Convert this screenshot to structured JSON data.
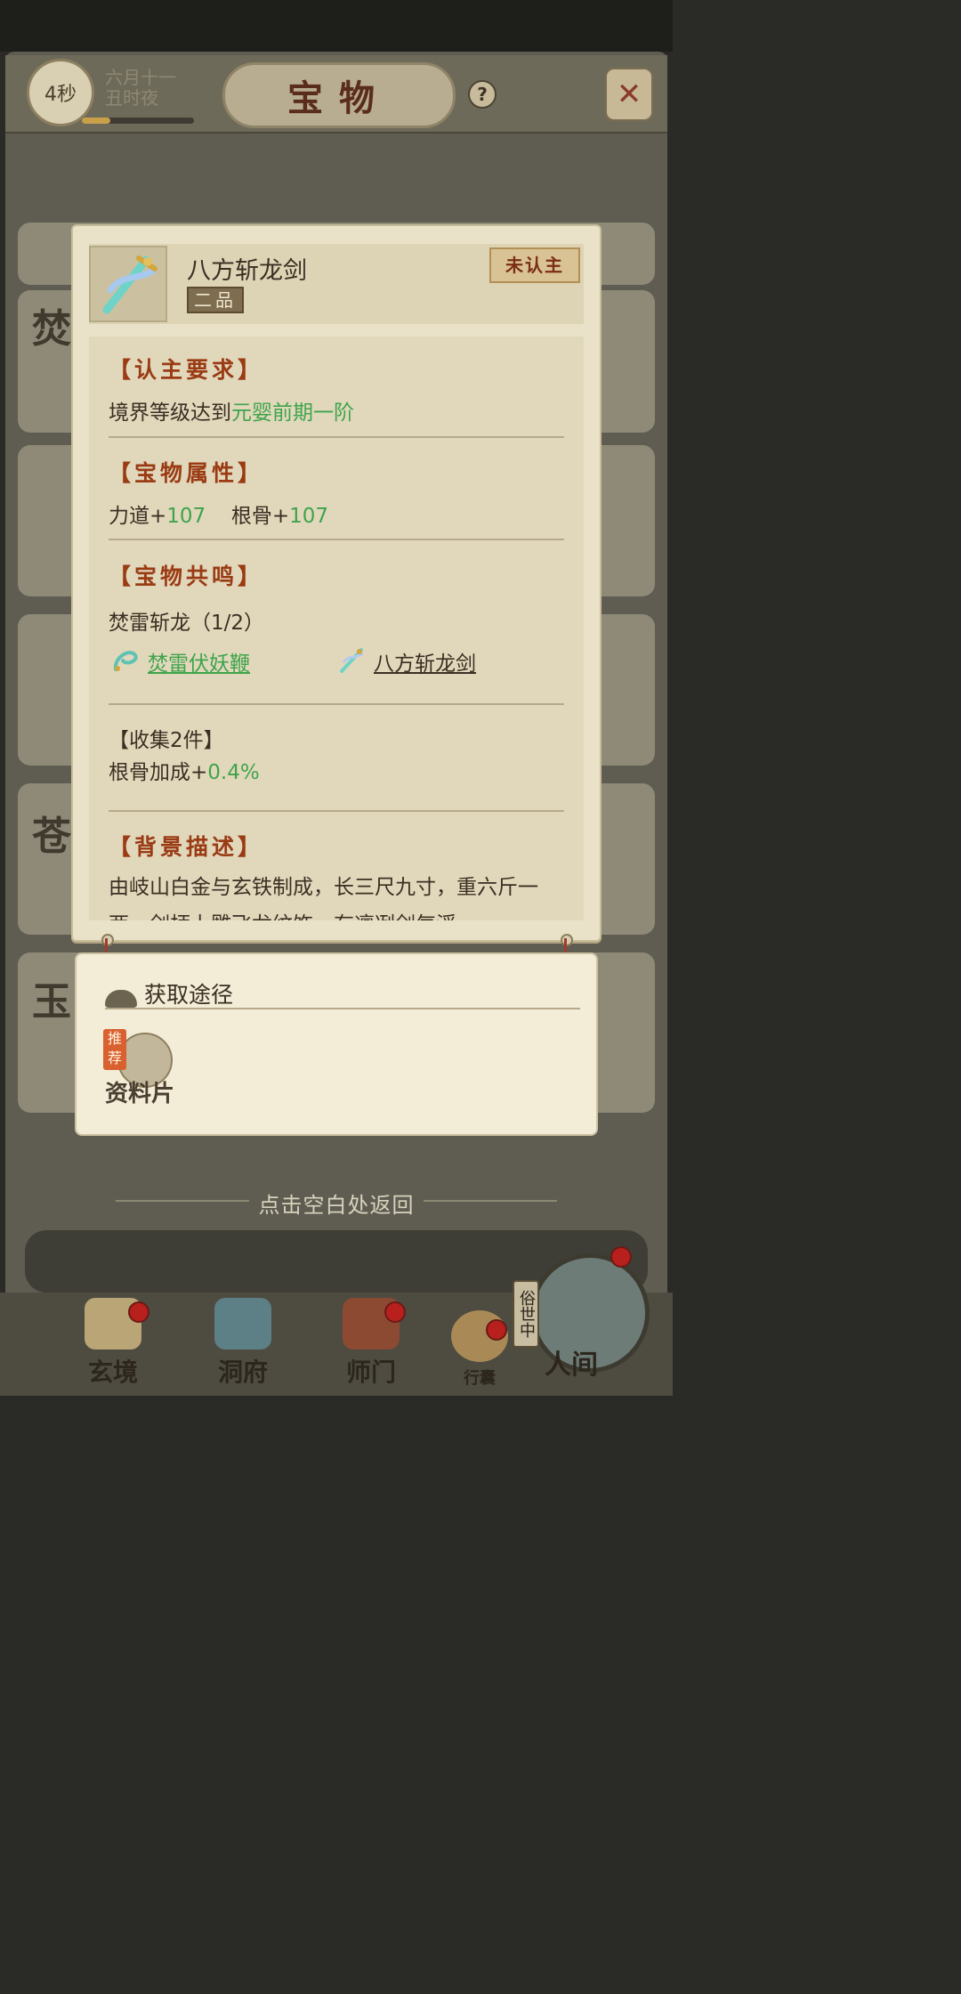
{
  "header": {
    "timer": "4秒",
    "date_line1": "六月十一",
    "date_line2": "丑时夜",
    "date_progress": 0.25,
    "title": "宝物",
    "help_icon": "question-mark-icon",
    "close_icon": "close-x-icon"
  },
  "item": {
    "name": "八方斩龙剑",
    "grade": "二品",
    "status": "未认主",
    "icon": "sword-icon"
  },
  "requirement": {
    "title": "【认主要求】",
    "text_prefix": "境界等级达到",
    "text_value": "元婴前期一阶"
  },
  "attributes": {
    "title": "【宝物属性】",
    "items": [
      {
        "label": "力道+",
        "value": "107"
      },
      {
        "label": "根骨+",
        "value": "107"
      }
    ]
  },
  "resonance": {
    "title": "【宝物共鸣】",
    "set_name": "焚雷斩龙（1/2）",
    "pieces": [
      {
        "name": "焚雷伏妖鞭",
        "icon": "whip-icon",
        "color": "#3fa44b"
      },
      {
        "name": "八方斩龙剑",
        "icon": "sword-icon",
        "color": "#3a2f22"
      }
    ],
    "bonus_title": "【收集2件】",
    "bonus_label": "根骨加成+",
    "bonus_value": "0.4%"
  },
  "background": {
    "title": "【背景描述】",
    "text": "由岐山白金与玄铁制成，长三尺九寸，重六斤一两，剑柄上雕飞龙纹饰，有凛冽剑气浮"
  },
  "acquire": {
    "title": "获取途径",
    "tag": "推荐",
    "source": "资料片"
  },
  "return_hint": "点击空白处返回",
  "nav": {
    "items": [
      {
        "label": "玄境",
        "icon": "scroll-icon"
      },
      {
        "label": "洞府",
        "icon": "pavilion-icon"
      },
      {
        "label": "师门",
        "icon": "banner-icon"
      },
      {
        "label": "行囊",
        "icon": "bag-icon"
      },
      {
        "label": "人间",
        "icon": "mountain-icon"
      }
    ],
    "world_tag": "俗世中"
  },
  "colors": {
    "accent_green": "#3fa44b",
    "section_title": "#9a3b14",
    "badge_red": "#b8201e"
  }
}
